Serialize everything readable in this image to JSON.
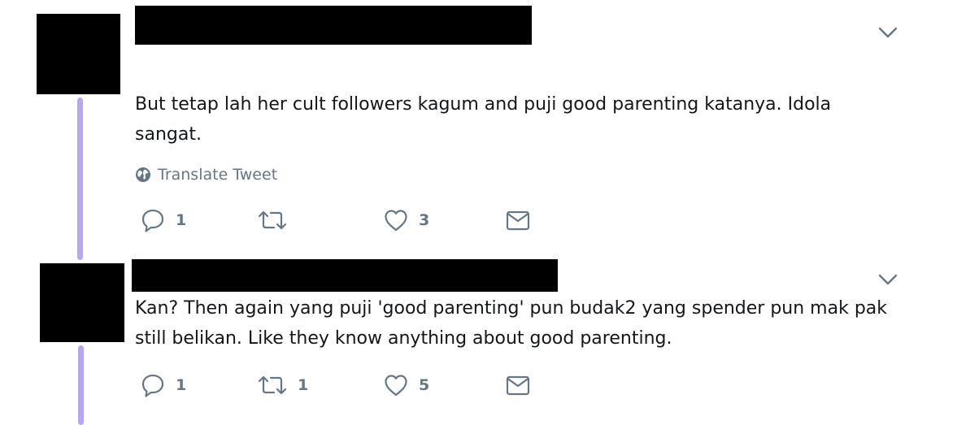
{
  "tweets": [
    {
      "text": "But tetap lah her cult followers kagum and puji good parenting katanya. Idola sangat.",
      "translate_label": "Translate Tweet",
      "reply_count": "1",
      "retweet_count": "",
      "like_count": "3"
    },
    {
      "text": "Kan? Then again yang puji 'good parenting' pun budak2 yang spender pun mak pak still belikan. Like they know anything about good parenting.",
      "reply_count": "1",
      "retweet_count": "1",
      "like_count": "5"
    }
  ],
  "icons": {
    "reply": "reply-icon",
    "retweet": "retweet-icon",
    "like": "heart-icon",
    "dm": "envelope-icon",
    "globe": "globe-icon",
    "caret": "chevron-down-icon"
  },
  "colors": {
    "text": "#14171a",
    "muted": "#657786",
    "thread_line": "#b8a5f3",
    "redaction": "#000000"
  }
}
